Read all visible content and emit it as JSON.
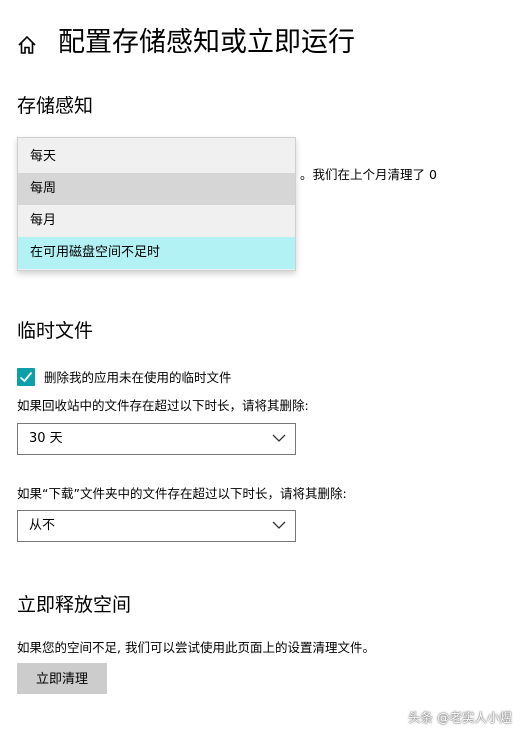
{
  "header": {
    "title": "配置存储感知或立即运行"
  },
  "storage_sense": {
    "heading": "存储感知",
    "obscured_text": "。我们在上个月清理了 0",
    "frequency_menu": {
      "options": [
        {
          "label": "每天",
          "state": "normal"
        },
        {
          "label": "每周",
          "state": "hover"
        },
        {
          "label": "每月",
          "state": "normal"
        },
        {
          "label": "在可用磁盘空间不足时",
          "state": "selected"
        }
      ]
    }
  },
  "temp_files": {
    "heading": "临时文件",
    "checkbox_label": "删除我的应用未在使用的临时文件",
    "checkbox_checked": true,
    "recycle_label": "如果回收站中的文件存在超过以下时长，请将其删除:",
    "recycle_value": "30 天",
    "downloads_label": "如果“下载”文件夹中的文件存在超过以下时长，请将其删除:",
    "downloads_value": "从不"
  },
  "free_space": {
    "heading": "立即释放空间",
    "description": "如果您的空间不足, 我们可以尝试使用此页面上的设置清理文件。",
    "button_label": "立即清理"
  },
  "watermark": "头条 @老实人小煜",
  "colors": {
    "accent": "#0a9fa9",
    "selected_option": "#b2f1f4",
    "button": "#cccccc"
  }
}
